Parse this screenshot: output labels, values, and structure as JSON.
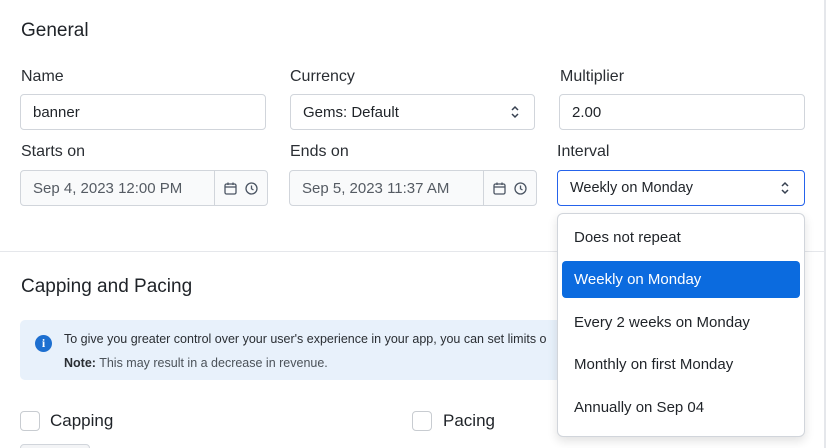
{
  "general": {
    "title": "General",
    "name": {
      "label": "Name",
      "value": "banner"
    },
    "currency": {
      "label": "Currency",
      "value": "Gems: Default"
    },
    "multiplier": {
      "label": "Multiplier",
      "value": "2.00"
    },
    "starts_on": {
      "label": "Starts on",
      "value": "Sep 4, 2023 12:00 PM"
    },
    "ends_on": {
      "label": "Ends on",
      "value": "Sep 5, 2023 11:37 AM"
    },
    "interval": {
      "label": "Interval",
      "value": "Weekly on Monday",
      "options": [
        "Does not repeat",
        "Weekly on Monday",
        "Every 2 weeks on Monday",
        "Monthly on first Monday",
        "Annually on Sep 04"
      ],
      "selected_index": 1
    }
  },
  "capping": {
    "title": "Capping and Pacing",
    "info_text": "To give you greater control over your user's experience in your app, you can set limits o",
    "note_label": "Note:",
    "note_text": " This may result in a decrease in revenue.",
    "capping_label": "Capping",
    "pacing_label": "Pacing"
  },
  "colors": {
    "accent": "#0b6bdf",
    "info_bg": "#e8f1fb",
    "info_icon": "#1d6fd0",
    "border": "#d1d5db"
  },
  "icons": [
    "chevron-updown-icon",
    "calendar-icon",
    "clock-icon",
    "info-icon"
  ]
}
